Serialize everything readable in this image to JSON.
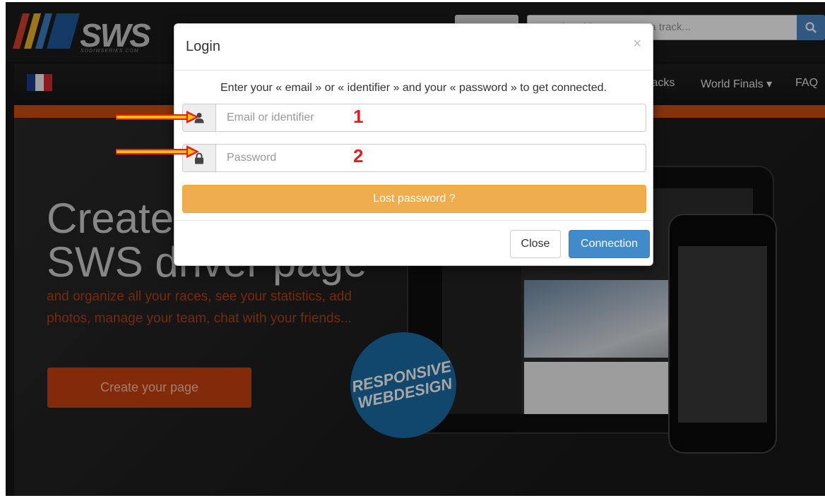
{
  "site": {
    "logo_text": "SWS",
    "logo_subtext": "SODIWSERIES.COM",
    "search_placeholder": "Search a driver, a team, a track...",
    "nav": {
      "tracks": "Tracks",
      "world_finals": "World Finals",
      "world_finals_caret": "▾",
      "faq": "FAQ"
    },
    "hero": {
      "title_line1": "Create your",
      "title_line2": "SWS driver page",
      "subtitle": "and organize all your races, see your statistics, add photos, manage your team, chat with your friends...",
      "cta": "Create your page",
      "badge_line1": "RESPONSIVE",
      "badge_line2": "WEBDESIGN"
    }
  },
  "modal": {
    "title": "Login",
    "close_glyph": "×",
    "intro": "Enter your « email » or « identifier » and your « password » to get connected.",
    "email_placeholder": "Email or identifier",
    "password_placeholder": "Password",
    "lost_password": "Lost password ?",
    "close_label": "Close",
    "connection_label": "Connection"
  },
  "annotations": {
    "step1": "1",
    "step2": "2"
  },
  "icons": {
    "email_field": "user-icon",
    "password_field": "lock-icon",
    "search": "search-icon"
  },
  "colors": {
    "accent_orange": "#d24e12",
    "warning": "#f0ad4e",
    "primary": "#428bca",
    "annotation_red": "#e31c1c"
  }
}
